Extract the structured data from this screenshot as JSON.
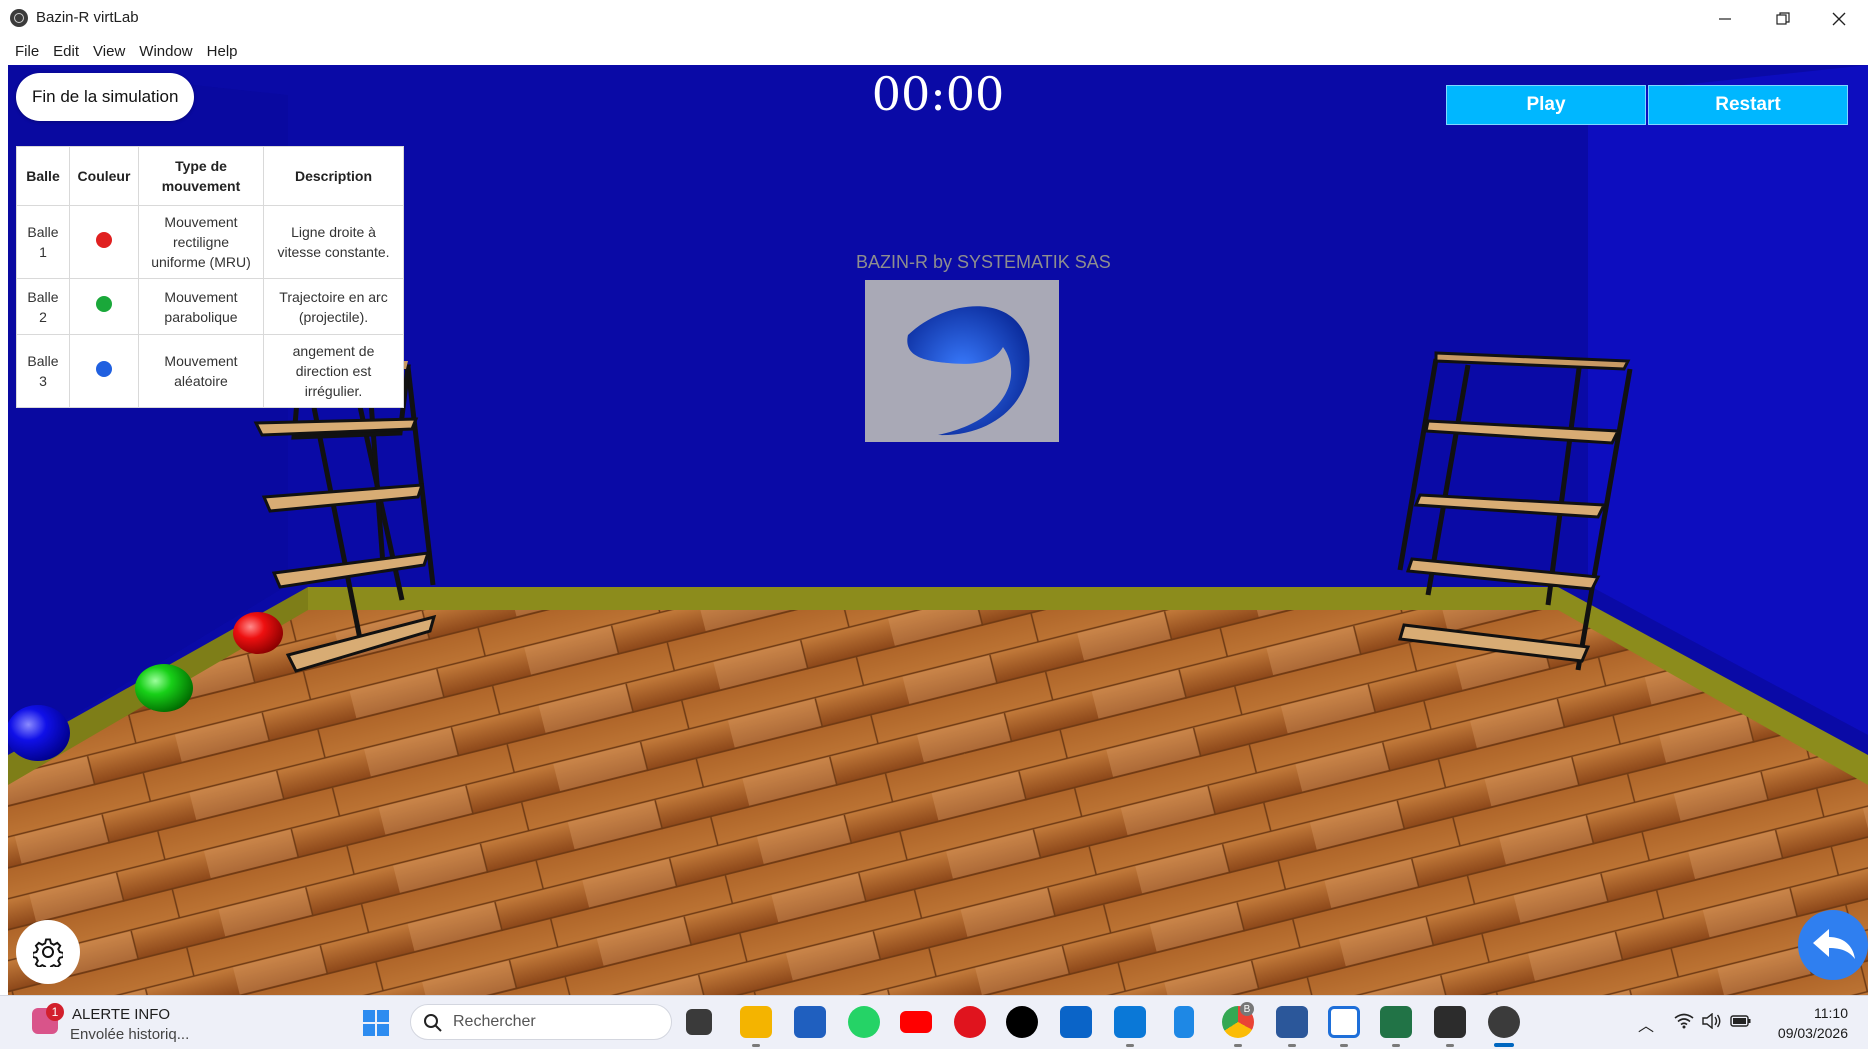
{
  "window": {
    "title": "Bazin-R virtLab"
  },
  "menu": [
    "File",
    "Edit",
    "View",
    "Window",
    "Help"
  ],
  "simulation": {
    "end_button": "Fin de la simulation",
    "timer": "00:00",
    "play_button": "Play",
    "restart_button": "Restart",
    "brand_text": "BAZIN-R by SYSTEMATIK SAS"
  },
  "table": {
    "headers": [
      "Balle",
      "Couleur",
      "Type de mouvement",
      "Description"
    ],
    "rows": [
      {
        "ball": "Balle 1",
        "color": "#e02020",
        "type": "Mouvement rectiligne uniforme (MRU)",
        "description": "Ligne droite à vitesse constante."
      },
      {
        "ball": "Balle 2",
        "color": "#1aa83a",
        "type": "Mouvement parabolique",
        "description": "Trajectoire en arc (projectile)."
      },
      {
        "ball": "Balle 3",
        "color": "#2060e0",
        "type": "Mouvement aléatoire",
        "description": "angement de direction est irrégulier."
      }
    ]
  },
  "taskbar": {
    "alert_badge": "1",
    "alert_title": "ALERTE INFO",
    "alert_subtitle": "Envolée historiq...",
    "search_placeholder": "Rechercher",
    "chrome_badge": "B",
    "time": "11:10",
    "date": "09/03/2026"
  },
  "colors": {
    "wall": "#0a0aa6",
    "baseboard": "#8a8a1a",
    "button_accent": "#00b7ff",
    "back_button": "#2f7ff0"
  }
}
